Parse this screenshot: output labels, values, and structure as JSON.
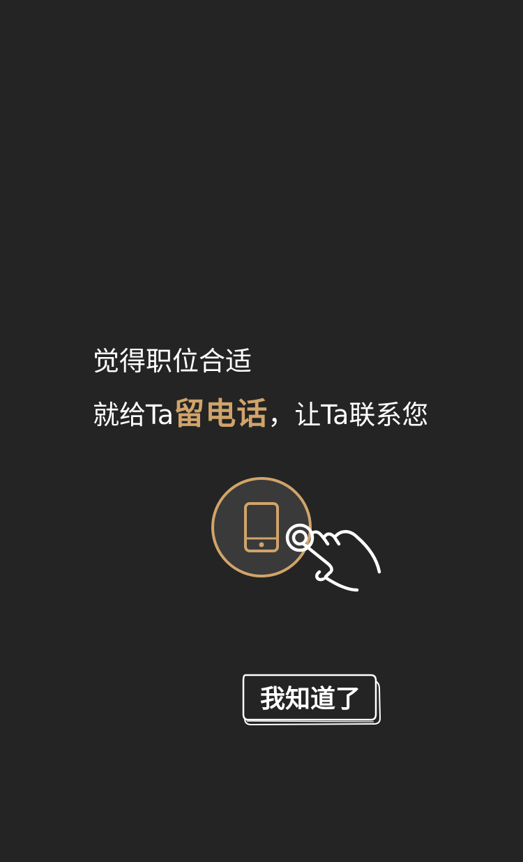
{
  "guide": {
    "line1": "觉得职位合适",
    "line2_prefix": "就给Ta",
    "line2_highlight": "留电话",
    "line2_suffix": "，让Ta联系您",
    "button_label": "我知道了"
  },
  "icons": {
    "phone": "phone-icon",
    "hand": "tap-hand-icon"
  },
  "colors": {
    "background": "#242424",
    "accent": "#d0a46a",
    "text": "#ffffff"
  }
}
